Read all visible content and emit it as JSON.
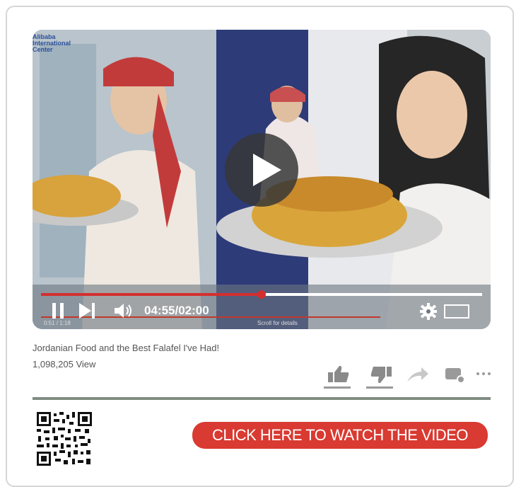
{
  "video": {
    "watermark": "Alibaba\nInternational\nCenter",
    "time_display": "04:55/02:00",
    "progress_fraction": 0.5,
    "small_time": "0:51 / 1:18",
    "scroll_hint": "Scroll for details"
  },
  "meta": {
    "title": "Jordanian Food and the Best Falafel I've Had!",
    "views": "1,098,205  View"
  },
  "cta": {
    "label": "CLICK HERE TO WATCH THE VIDEO"
  },
  "colors": {
    "accent": "#d32f2f",
    "cta": "#d93a31",
    "divider": "#7f8c82",
    "icon": "#9a9a9a"
  },
  "icons": [
    "play-icon",
    "pause-icon",
    "next-icon",
    "volume-icon",
    "settings-gear-icon",
    "fullscreen-icon",
    "thumbs-up-icon",
    "thumbs-down-icon",
    "share-icon",
    "comment-icon",
    "more-icon",
    "qr-code-icon"
  ]
}
